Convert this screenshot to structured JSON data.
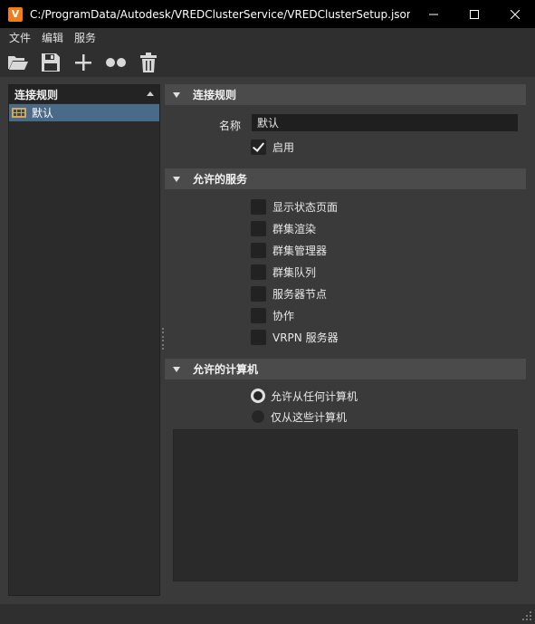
{
  "window": {
    "app_icon_letter": "V",
    "title": "C:/ProgramData/Autodesk/VREDClusterService/VREDClusterSetup.json…",
    "icons": {
      "minimize": "minimize-icon",
      "maximize": "maximize-icon",
      "close": "close-icon"
    }
  },
  "menu": {
    "file": "文件",
    "edit": "编辑",
    "service": "服务"
  },
  "toolbar": {
    "icons": [
      "folder-open-icon",
      "save-icon",
      "add-icon",
      "duplicate-icon",
      "trash-icon"
    ]
  },
  "rules_panel": {
    "header": "连接规则",
    "items": [
      {
        "label": "默认",
        "icon": "table-icon"
      }
    ]
  },
  "sections": {
    "connection_rule": {
      "title": "连接规则",
      "name_label": "名称",
      "name_value": "默认",
      "enable": {
        "label": "启用",
        "checked": true
      }
    },
    "allowed_services": {
      "title": "允许的服务",
      "items": [
        {
          "label": "显示状态页面",
          "checked": false
        },
        {
          "label": "群集渲染",
          "checked": false
        },
        {
          "label": "群集管理器",
          "checked": false
        },
        {
          "label": "群集队列",
          "checked": false
        },
        {
          "label": "服务器节点",
          "checked": false
        },
        {
          "label": "协作",
          "checked": false
        },
        {
          "label": "VRPN 服务器",
          "checked": false
        }
      ]
    },
    "allowed_computers": {
      "title": "允许的计算机",
      "options": [
        {
          "label": "允许从任何计算机",
          "selected": true
        },
        {
          "label": "仅从这些计算机",
          "selected": false
        }
      ]
    }
  },
  "colors": {
    "accent_selection": "#4a6a8a",
    "app_icon": "#f07d1a"
  }
}
